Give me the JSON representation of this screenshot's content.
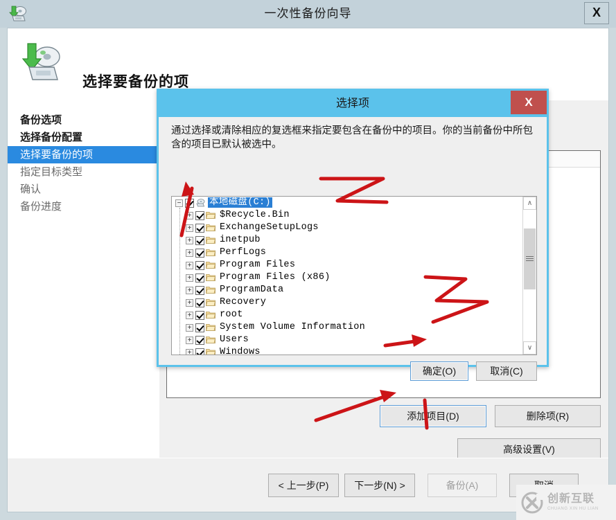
{
  "window": {
    "title": "一次性备份向导",
    "close_label": "X",
    "app_icon": "backup-disk-icon",
    "heading": "选择要备份的项"
  },
  "sidebar": {
    "items": [
      {
        "label": "备份选项",
        "state": "done"
      },
      {
        "label": "选择备份配置",
        "state": "done"
      },
      {
        "label": "选择要备份的项",
        "state": "current"
      },
      {
        "label": "指定目标类型",
        "state": "pending"
      },
      {
        "label": "确认",
        "state": "pending"
      },
      {
        "label": "备份进度",
        "state": "pending"
      }
    ]
  },
  "content": {
    "add_items_label": "添加项目(D)",
    "remove_items_label": "删除项(R)",
    "advanced_settings_label": "高级设置(V)"
  },
  "nav": {
    "prev_label": "< 上一步(P)",
    "next_label": "下一步(N) >",
    "backup_label": "备份(A)",
    "backup_disabled": true,
    "cancel_label": "取消"
  },
  "dialog": {
    "title": "选择项",
    "close_label": "X",
    "instructions": "通过选择或清除相应的复选框来指定要包含在备份中的项目。你的当前备份中所包含的项目已默认被选中。",
    "ok_label": "确定(O)",
    "cancel_label": "取消(C)",
    "tree": {
      "root": {
        "label": "本地磁盘(C:)",
        "icon": "drive-icon",
        "checked": true,
        "expanded": true,
        "selected": true,
        "expander": "−"
      },
      "children": [
        {
          "label": "$Recycle.Bin",
          "icon": "folder-icon",
          "checked": true,
          "expander": "+"
        },
        {
          "label": "ExchangeSetupLogs",
          "icon": "folder-icon",
          "checked": true,
          "expander": "+"
        },
        {
          "label": "inetpub",
          "icon": "folder-icon",
          "checked": true,
          "expander": "+"
        },
        {
          "label": "PerfLogs",
          "icon": "folder-icon",
          "checked": true,
          "expander": "+"
        },
        {
          "label": "Program Files",
          "icon": "folder-icon",
          "checked": true,
          "expander": "+"
        },
        {
          "label": "Program Files (x86)",
          "icon": "folder-icon",
          "checked": true,
          "expander": "+"
        },
        {
          "label": "ProgramData",
          "icon": "folder-icon",
          "checked": true,
          "expander": "+"
        },
        {
          "label": "Recovery",
          "icon": "folder-icon",
          "checked": true,
          "expander": "+"
        },
        {
          "label": "root",
          "icon": "folder-icon",
          "checked": true,
          "expander": "+"
        },
        {
          "label": "System Volume Information",
          "icon": "folder-icon",
          "checked": true,
          "expander": "+"
        },
        {
          "label": "Users",
          "icon": "folder-icon",
          "checked": true,
          "expander": "+"
        },
        {
          "label": "Windows",
          "icon": "folder-icon",
          "checked": true,
          "expander": "+"
        }
      ],
      "scrollbar": {
        "up_glyph": "∧",
        "down_glyph": "∨"
      }
    }
  },
  "annotation_color": "#cc1417",
  "watermark": {
    "cn": "创新互联",
    "en": "CHUANG XIN HU LIAN",
    "logo": "circle-x-logo"
  }
}
